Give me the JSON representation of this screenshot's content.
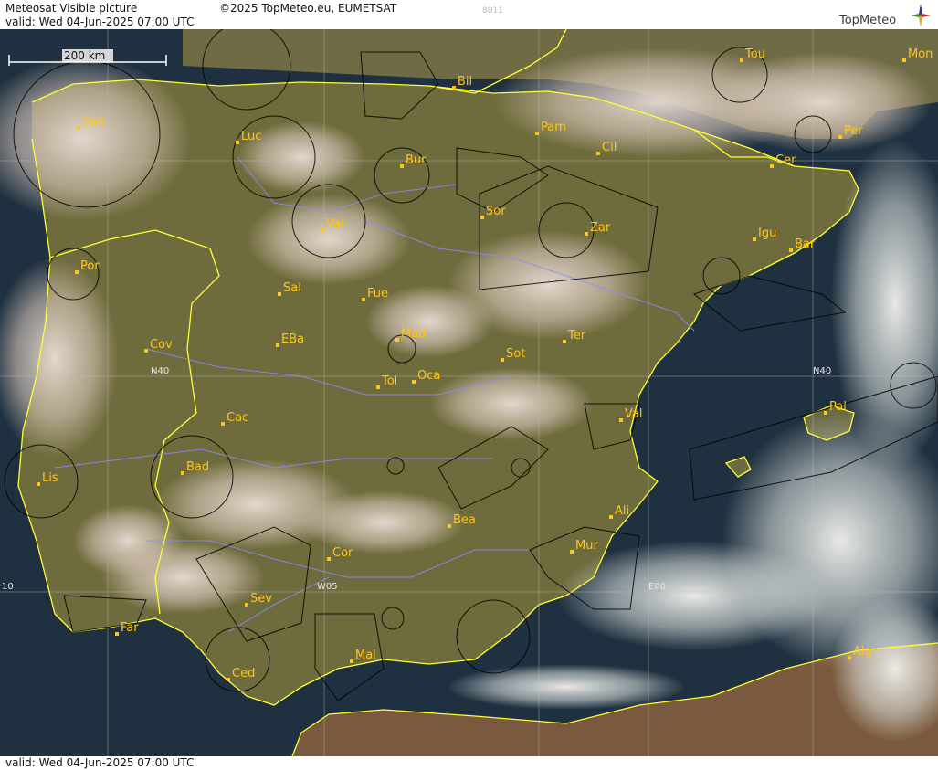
{
  "header": {
    "title": "Meteosat Visible picture",
    "copyright": "©2025 TopMeteo.eu, EUMETSAT",
    "valid": "valid:  Wed  04-Jun-2025  07:00 UTC",
    "image_id": "8011",
    "logo": "TopMeteo"
  },
  "footer": {
    "valid": "valid:  Wed  04-Jun-2025  07:00 UTC"
  },
  "map": {
    "scale_label": "200 km",
    "grid_labels": [
      "N40",
      "N40",
      "W05",
      "E00",
      "10"
    ],
    "cities": [
      "San",
      "Luc",
      "Bil",
      "Pam",
      "Cil",
      "Tou",
      "Mon",
      "Per",
      "Cer",
      "Bur",
      "Sor",
      "Zar",
      "Igu",
      "Bar",
      "Val",
      "Por",
      "Sal",
      "Fue",
      "Mad",
      "EBa",
      "Cov",
      "Ter",
      "Sot",
      "Tol",
      "Oca",
      "Val",
      "Cac",
      "Pal",
      "Bad",
      "Lis",
      "Bea",
      "Ali",
      "Mur",
      "Cor",
      "Sev",
      "Far",
      "Ced",
      "Mal",
      "Alg"
    ],
    "colors": {
      "land": "#6b6a3a",
      "sea": "#1d2e3c",
      "coast": "#ffff33",
      "rivers": "#8c8cff",
      "airspace": "#000000",
      "labels": "#ffc61a"
    }
  }
}
